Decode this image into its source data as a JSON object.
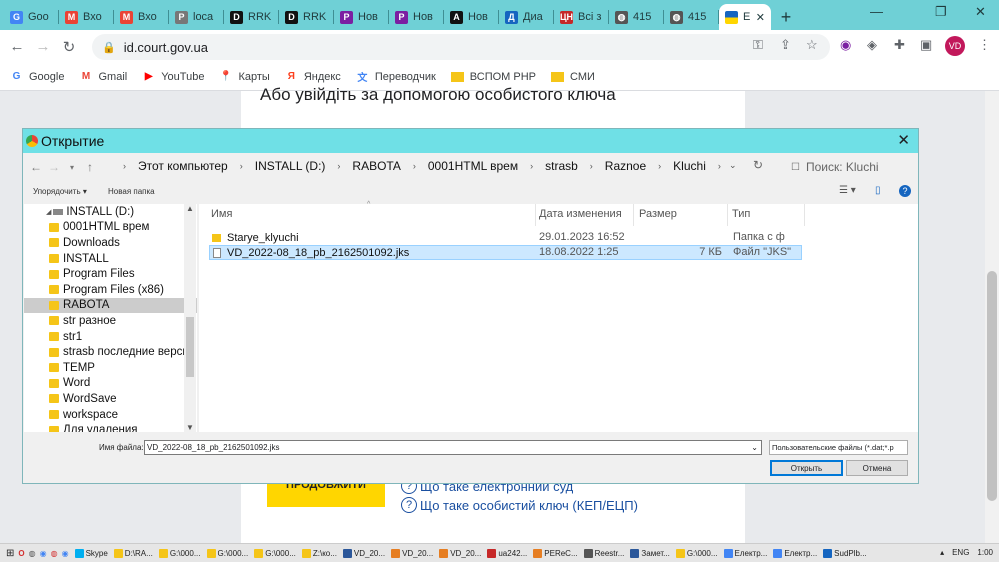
{
  "browser": {
    "tabs": [
      {
        "label": "Goo",
        "icon": "G",
        "color": "#4285f4"
      },
      {
        "label": "Вхо",
        "icon": "M",
        "color": "#ea4335"
      },
      {
        "label": "Вхо",
        "icon": "M",
        "color": "#ea4335"
      },
      {
        "label": "loca",
        "icon": "P",
        "color": "#777777"
      },
      {
        "label": "RRK",
        "icon": "D",
        "color": "#111111"
      },
      {
        "label": "RRK",
        "icon": "D",
        "color": "#111111"
      },
      {
        "label": "Нов",
        "icon": "P",
        "color": "#7b1fa2"
      },
      {
        "label": "Нов",
        "icon": "P",
        "color": "#7b1fa2"
      },
      {
        "label": "Нов",
        "icon": "A",
        "color": "#111111"
      },
      {
        "label": "Диа",
        "icon": "Д",
        "color": "#1565c0"
      },
      {
        "label": "Всі з",
        "icon": "ЦН",
        "color": "#c62828"
      },
      {
        "label": "415",
        "icon": "◍",
        "color": "#555555"
      },
      {
        "label": "415",
        "icon": "◍",
        "color": "#555555"
      }
    ],
    "active_tab": {
      "label": "Е",
      "close": "✕"
    },
    "new_tab": "+",
    "window_controls": {
      "minimize": "—",
      "restore": "❐",
      "close": "✕"
    },
    "url": "id.court.gov.ua",
    "avatar": "VD",
    "bookmarks": [
      {
        "label": "Google",
        "icon": "G",
        "color": "#4285f4"
      },
      {
        "label": "Gmail",
        "icon": "M",
        "color": "#ea4335"
      },
      {
        "label": "YouTube",
        "icon": "▶",
        "color": "#ff0000"
      },
      {
        "label": "Карты",
        "icon": "📍",
        "color": "#34a853"
      },
      {
        "label": "Яндекс",
        "icon": "Я",
        "color": "#fc3f1d"
      },
      {
        "label": "Переводчик",
        "icon": "文",
        "color": "#4285f4"
      },
      {
        "label": "ВСПОМ PHP",
        "icon": "",
        "color": "#f5c518"
      },
      {
        "label": "СМИ",
        "icon": "",
        "color": "#f5c518"
      }
    ]
  },
  "page": {
    "heading": "Або увійдіть за допомогою особистого ключа",
    "continue_button": "ПРОДОВЖИТИ",
    "help_links": [
      "Що таке електронний суд",
      "Що таке особистий ключ (КЕП/ЕЦП)"
    ]
  },
  "dialog": {
    "title": "Открытие",
    "close": "✕",
    "breadcrumbs": [
      "Этот компьютер",
      "INSTALL (D:)",
      "RABOTA",
      "0001HTML врем",
      "strasb",
      "Raznoe",
      "Kluchi"
    ],
    "search_placeholder": "Поиск: Kluchi",
    "organize": "Упорядочить ▾",
    "new_folder": "Новая папка",
    "nav_items": [
      {
        "label": "INSTALL (D:)",
        "type": "drive",
        "selected": false
      },
      {
        "label": "0001HTML врем",
        "type": "folder",
        "selected": false
      },
      {
        "label": "Downloads",
        "type": "folder",
        "selected": false
      },
      {
        "label": "INSTALL",
        "type": "folder",
        "selected": false
      },
      {
        "label": "Program Files",
        "type": "folder",
        "selected": false
      },
      {
        "label": "Program Files (x86)",
        "type": "folder",
        "selected": false
      },
      {
        "label": "RABOTA",
        "type": "folder",
        "selected": true
      },
      {
        "label": "str разное",
        "type": "folder",
        "selected": false
      },
      {
        "label": "str1",
        "type": "folder",
        "selected": false
      },
      {
        "label": "strasb последние версии",
        "type": "folder",
        "selected": false
      },
      {
        "label": "TEMP",
        "type": "folder",
        "selected": false
      },
      {
        "label": "Word",
        "type": "folder",
        "selected": false
      },
      {
        "label": "WordSave",
        "type": "folder",
        "selected": false
      },
      {
        "label": "workspace",
        "type": "folder",
        "selected": false
      },
      {
        "label": "Для удаления",
        "type": "folder",
        "selected": false
      }
    ],
    "columns": {
      "name": "Имя",
      "date": "Дата изменения",
      "size": "Размер",
      "type": "Тип"
    },
    "files": [
      {
        "name": "Starye_klyuchi",
        "date": "29.01.2023 16:52",
        "size": "",
        "type": "Папка с ф",
        "kind": "folder",
        "selected": false
      },
      {
        "name": "VD_2022-08_18_pb_2162501092.jks",
        "date": "18.08.2022 1:25",
        "size": "7 КБ",
        "type": "Файл \"JKS\"",
        "kind": "file",
        "selected": true
      }
    ],
    "filename_label": "Имя файла:",
    "filename_value": "VD_2022-08_18_pb_2162501092.jks",
    "filetype": "Пользовательские файлы (*.dat;*.p",
    "open_button": "Открыть",
    "cancel_button": "Отмена"
  },
  "taskbar": {
    "items": [
      {
        "label": "Skype",
        "color": "#00aff0"
      },
      {
        "label": "D:\\RA...",
        "color": "#f5c518"
      },
      {
        "label": "G:\\000...",
        "color": "#f5c518"
      },
      {
        "label": "G:\\000...",
        "color": "#f5c518"
      },
      {
        "label": "G:\\000...",
        "color": "#f5c518"
      },
      {
        "label": "Z:\\ко...",
        "color": "#f5c518"
      },
      {
        "label": "VD_20...",
        "color": "#2b579a"
      },
      {
        "label": "VD_20...",
        "color": "#e67e22"
      },
      {
        "label": "VD_20...",
        "color": "#e67e22"
      },
      {
        "label": "ua242...",
        "color": "#c62828"
      },
      {
        "label": "PERеC...",
        "color": "#e67e22"
      },
      {
        "label": "Reestr...",
        "color": "#555555"
      },
      {
        "label": "Замет...",
        "color": "#2b579a"
      },
      {
        "label": "G:\\000...",
        "color": "#f5c518"
      },
      {
        "label": "Електр...",
        "color": "#4285f4"
      },
      {
        "label": "Електр...",
        "color": "#4285f4"
      },
      {
        "label": "SudPlb...",
        "color": "#1565c0"
      }
    ],
    "lang": "ENG",
    "time": "1:00"
  }
}
